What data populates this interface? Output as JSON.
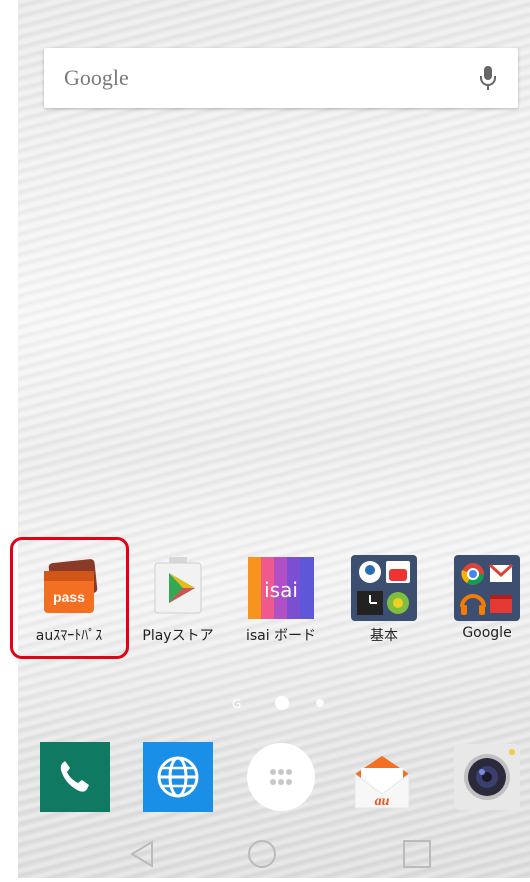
{
  "search": {
    "logo_text": "Google",
    "mic_icon": "microphone-icon"
  },
  "apps": [
    {
      "name": "au-smart-pass",
      "label": "auｽﾏｰﾄﾊﾟｽ",
      "icon_text": "pass",
      "color": "#e8541e"
    },
    {
      "name": "play-store",
      "label": "Playストア"
    },
    {
      "name": "isai-board",
      "label": "isai ボード",
      "icon_text": "isai"
    },
    {
      "name": "kihon-folder",
      "label": "基本"
    },
    {
      "name": "google-folder",
      "label": "Google"
    }
  ],
  "page_indicator": {
    "pages": 2,
    "current": 1
  },
  "dock": [
    {
      "name": "phone",
      "icon": "phone-icon",
      "color": "#0f7a61"
    },
    {
      "name": "browser",
      "icon": "globe-icon",
      "color": "#1a8fe8"
    },
    {
      "name": "app-drawer",
      "icon": "apps-grid-icon"
    },
    {
      "name": "au-mail",
      "icon": "mail-icon",
      "icon_text": "au"
    },
    {
      "name": "camera",
      "icon": "camera-icon"
    }
  ],
  "navbar": {
    "back": "back-icon",
    "home": "home-icon",
    "recents": "recents-icon"
  },
  "highlight_color": "#e60012"
}
